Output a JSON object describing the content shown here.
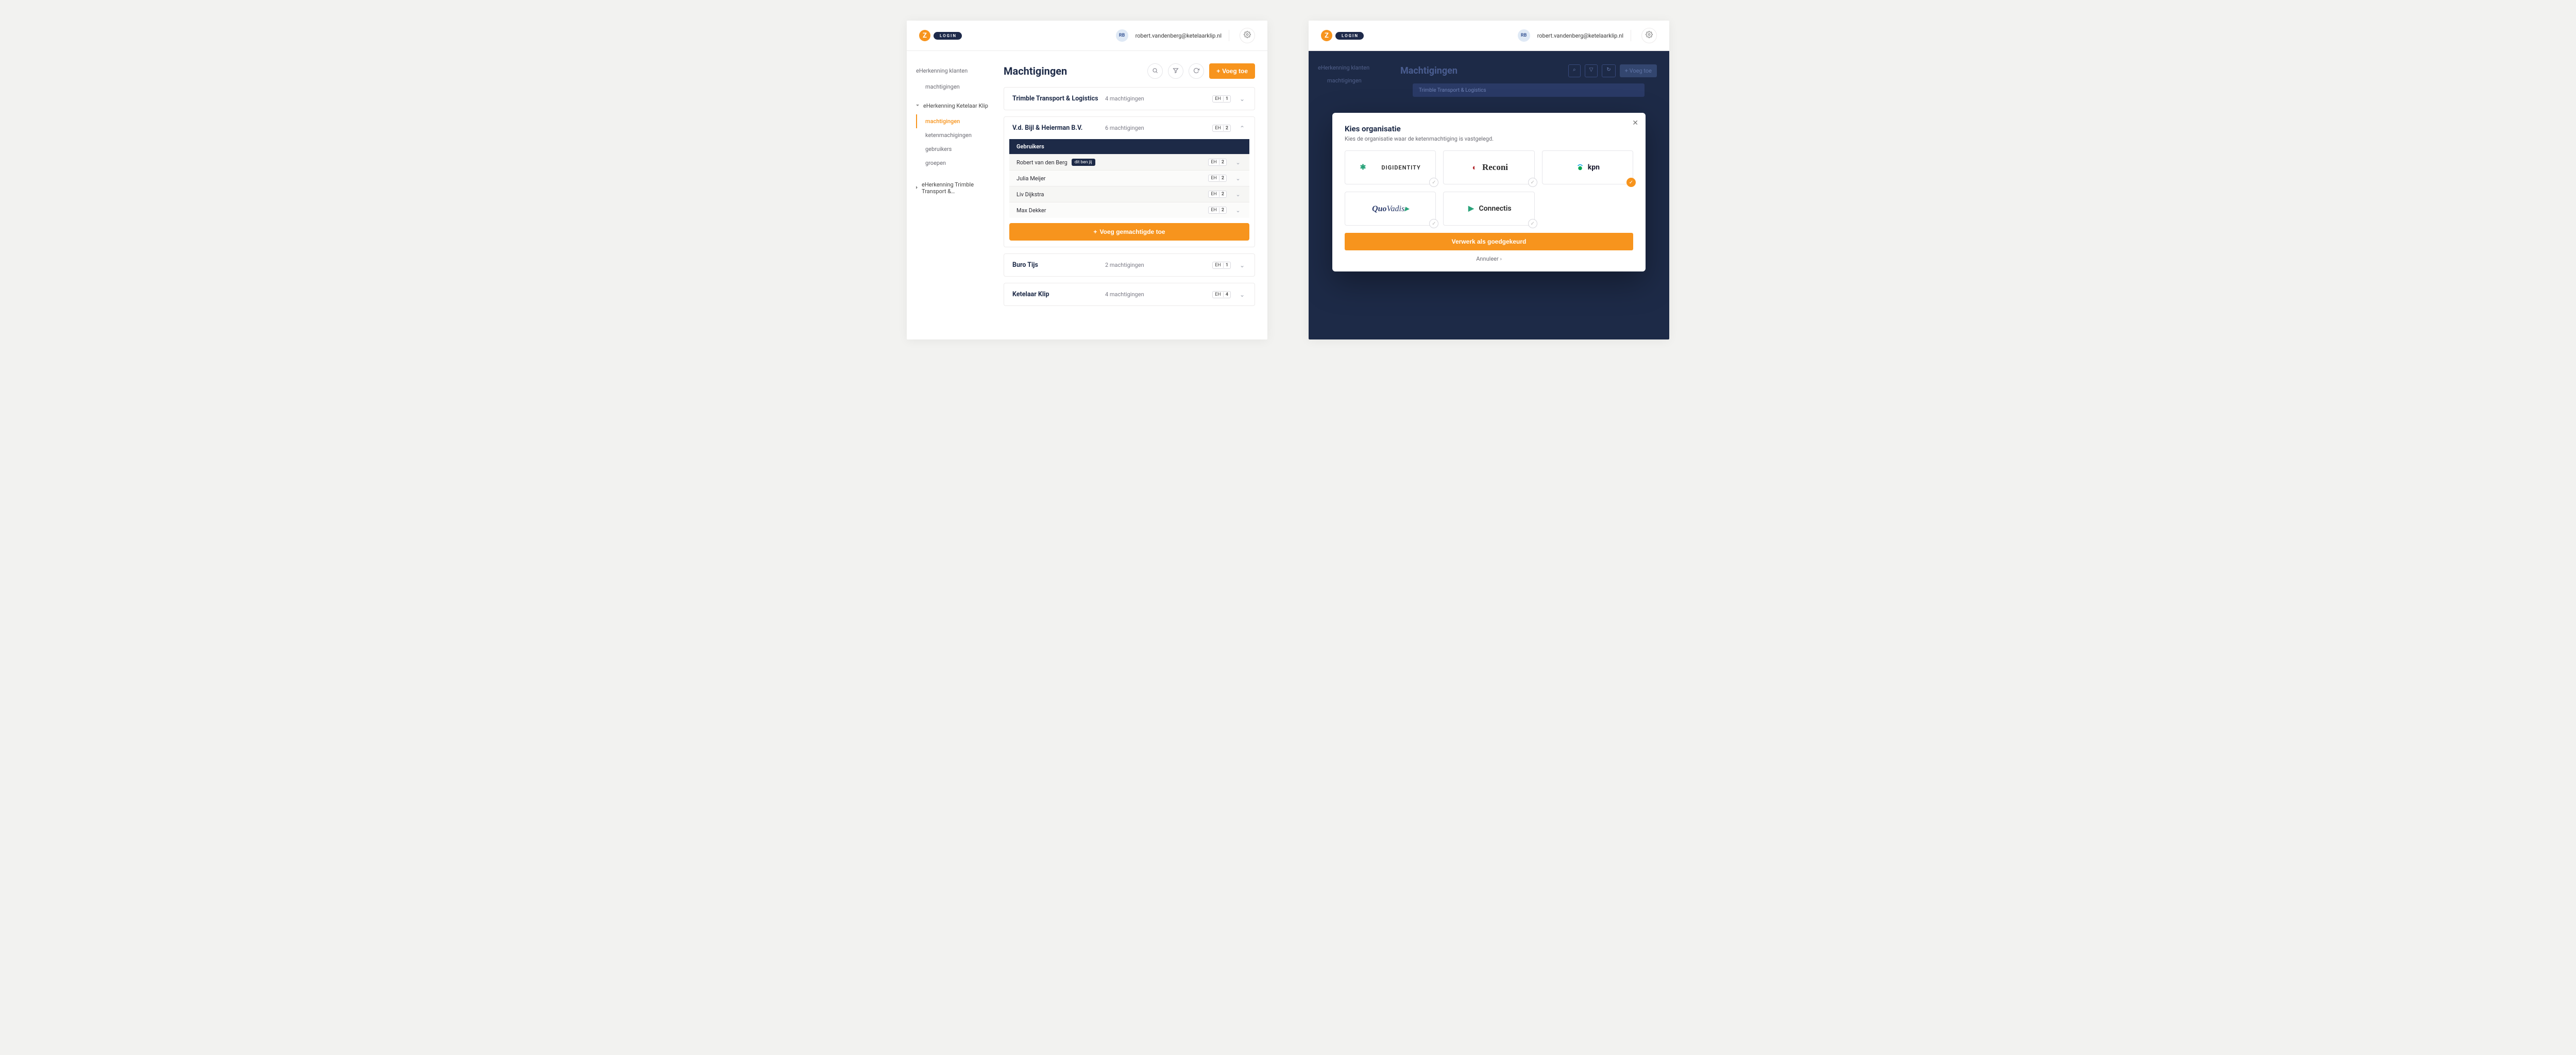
{
  "brand": {
    "letter": "Z",
    "word": "LOGIN"
  },
  "user": {
    "initials": "RB",
    "email": "robert.vandenberg@ketelaarklip.nl"
  },
  "sidebar": {
    "top_label": "eHerkenning klanten",
    "top_link": "machtigingen",
    "section1": {
      "label": "eHerkenning Ketelaar Klip",
      "items": [
        "machtigingen",
        "ketenmachigingen",
        "gebruikers",
        "groepen"
      ],
      "active_index": 0
    },
    "section2": {
      "label": "eHerkenning Trimble Transport &…"
    }
  },
  "main": {
    "title": "Machtigingen",
    "add_button": "Voeg toe",
    "orgs": [
      {
        "name": "Trimble Transport & Logistics",
        "meta": "4 machtigingen",
        "eh": "EH",
        "level": "1",
        "expanded": false
      },
      {
        "name": "V.d. Bijl & Heierman B.V.",
        "meta": "6 machtigingen",
        "eh": "EH",
        "level": "2",
        "expanded": true,
        "users_header": "Gebruikers",
        "users": [
          {
            "name": "Robert van den Berg",
            "you_tag": "dit ben jij",
            "eh": "EH",
            "level": "2"
          },
          {
            "name": "Julia Meijer",
            "eh": "EH",
            "level": "2"
          },
          {
            "name": "Liv Dijkstra",
            "eh": "EH",
            "level": "2"
          },
          {
            "name": "Max Dekker",
            "eh": "EH",
            "level": "2"
          }
        ],
        "add_user_label": "Voeg gemachtigde toe"
      },
      {
        "name": "Buro Tijs",
        "meta": "2 machtigingen",
        "eh": "EH",
        "level": "1",
        "expanded": false
      },
      {
        "name": "Ketelaar Klip",
        "meta": "4 machtigingen",
        "eh": "EH",
        "level": "4",
        "expanded": false
      }
    ]
  },
  "modal": {
    "title": "Kies organisatie",
    "subtitle": "Kies de organisatie waar de ketenmachtiging is vastgelegd.",
    "providers": [
      {
        "key": "digidentity",
        "label": "DIGIDENTITY"
      },
      {
        "key": "reconi",
        "label": "Reconi"
      },
      {
        "key": "kpn",
        "label": "kpn",
        "selected": true
      },
      {
        "key": "quovadis",
        "label": "QuoVadis"
      },
      {
        "key": "connectis",
        "label": "Connectis"
      }
    ],
    "primary": "Verwerk als goedgekeurd",
    "cancel": "Annuleer"
  },
  "ghost_right": {
    "title": "Machtigingen",
    "row1": "Trimble Transport & Logistics",
    "add": "+ Voeg toe"
  }
}
